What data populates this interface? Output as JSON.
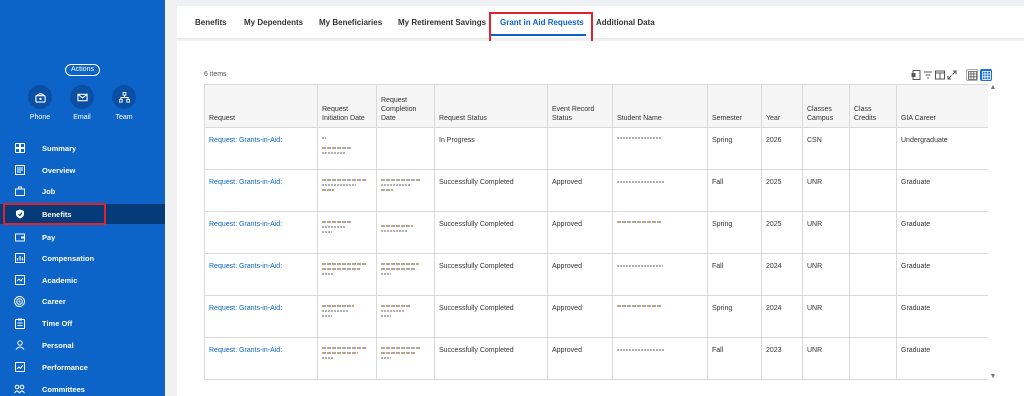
{
  "sidebar": {
    "actions_label": "Actions",
    "quick": [
      {
        "label": "Phone",
        "icon": "phone-icon"
      },
      {
        "label": "Email",
        "icon": "email-icon"
      },
      {
        "label": "Team",
        "icon": "team-icon"
      }
    ],
    "items": [
      {
        "label": "Summary",
        "icon": "summary-icon"
      },
      {
        "label": "Overview",
        "icon": "overview-icon"
      },
      {
        "label": "Job",
        "icon": "briefcase-icon"
      },
      {
        "label": "Benefits",
        "icon": "shield-icon",
        "active": true
      },
      {
        "label": "Pay",
        "icon": "wallet-icon"
      },
      {
        "label": "Compensation",
        "icon": "compensation-icon"
      },
      {
        "label": "Academic",
        "icon": "academic-icon"
      },
      {
        "label": "Career",
        "icon": "target-icon"
      },
      {
        "label": "Time Off",
        "icon": "clipboard-icon"
      },
      {
        "label": "Personal",
        "icon": "person-icon"
      },
      {
        "label": "Performance",
        "icon": "performance-icon"
      },
      {
        "label": "Committees",
        "icon": "committees-icon"
      }
    ]
  },
  "tabs": [
    {
      "label": "Benefits"
    },
    {
      "label": "My Dependents"
    },
    {
      "label": "My Beneficiaries"
    },
    {
      "label": "My Retirement Savings"
    },
    {
      "label": "Grant in Aid Requests",
      "active": true
    },
    {
      "label": "Additional Data"
    }
  ],
  "table": {
    "count_label": "6 items",
    "headers": [
      "Request",
      "Request Initiation Date",
      "Request Completion Date",
      "Request Status",
      "Event Record Status",
      "Student Name",
      "Semester",
      "Year",
      "Classes Campus",
      "Class Credits",
      "GIA Career"
    ],
    "rows": [
      {
        "request": "Request: Grants-in-Aid:",
        "status": "In Progress",
        "event": "",
        "semester": "Spring",
        "year": "2026",
        "campus": "CSN",
        "credits": "",
        "career": "Undergraduate"
      },
      {
        "request": "Request: Grants-in-Aid:",
        "status": "Successfully Completed",
        "event": "Approved",
        "semester": "Fall",
        "year": "2025",
        "campus": "UNR",
        "credits": "",
        "career": "Graduate"
      },
      {
        "request": "Request: Grants-in-Aid:",
        "status": "Successfully Completed",
        "event": "Approved",
        "semester": "Spring",
        "year": "2025",
        "campus": "UNR",
        "credits": "",
        "career": "Graduate"
      },
      {
        "request": "Request: Grants-in-Aid:",
        "status": "Successfully Completed",
        "event": "Approved",
        "semester": "Fall",
        "year": "2024",
        "campus": "UNR",
        "credits": "",
        "career": "Graduate"
      },
      {
        "request": "Request: Grants-in-Aid:",
        "status": "Successfully Completed",
        "event": "Approved",
        "semester": "Spring",
        "year": "2024",
        "campus": "UNR",
        "credits": "",
        "career": "Graduate"
      },
      {
        "request": "Request: Grants-in-Aid:",
        "status": "Successfully Completed",
        "event": "Approved",
        "semester": "Fall",
        "year": "2023",
        "campus": "UNR",
        "credits": "",
        "career": "Graduate"
      }
    ]
  },
  "colors": {
    "sidebar": "#0d64c8",
    "accent": "#0b64c8",
    "highlight": "#e0222a"
  }
}
